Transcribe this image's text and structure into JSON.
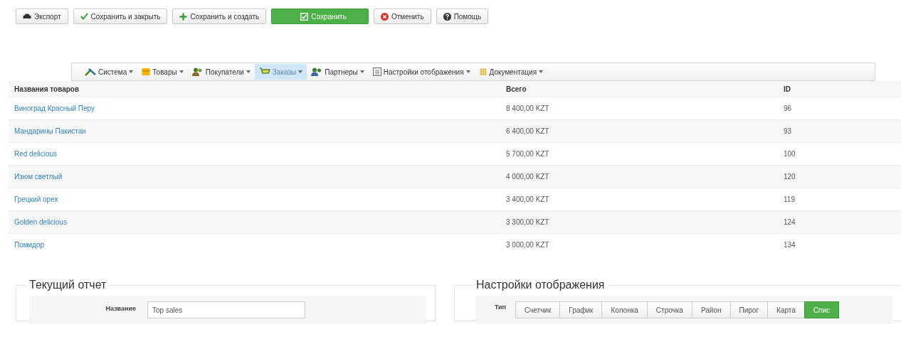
{
  "toolbar": {
    "buttons": [
      {
        "label": "Экспорт",
        "kind": "export"
      },
      {
        "label": "Сохранить и закрыть",
        "kind": "save_close"
      },
      {
        "label": "Сохранить и создать",
        "kind": "save_new"
      },
      {
        "label": "Сохранить",
        "kind": "save"
      },
      {
        "label": "Отменить",
        "kind": "cancel"
      },
      {
        "label": "Помощь",
        "kind": "help"
      }
    ]
  },
  "menu": {
    "items": [
      {
        "label": "Система",
        "kind": "system",
        "selected": false
      },
      {
        "label": "Товары",
        "kind": "goods",
        "selected": false
      },
      {
        "label": "Покупатели",
        "kind": "customers",
        "selected": false
      },
      {
        "label": "Заказы",
        "kind": "orders",
        "selected": true
      },
      {
        "label": "Партнеры",
        "kind": "partners",
        "selected": false
      },
      {
        "label": "Настройки отображения",
        "kind": "display",
        "selected": false
      },
      {
        "label": "Документация",
        "kind": "docs",
        "selected": false
      }
    ]
  },
  "table": {
    "columns": [
      "Названия товаров",
      "Всего",
      "ID"
    ],
    "rows": [
      {
        "name": "Виноград Красный Перу",
        "total": "8 400,00 KZT",
        "id": "96"
      },
      {
        "name": "Мандарины Пакистан",
        "total": "6 400,00 KZT",
        "id": "93"
      },
      {
        "name": "Red delicious",
        "total": "5 700,00 KZT",
        "id": "100"
      },
      {
        "name": "Изюм светлый",
        "total": "4 000,00 KZT",
        "id": "120"
      },
      {
        "name": "Грецкий орех",
        "total": "3 400,00 KZT",
        "id": "119"
      },
      {
        "name": "Golden delicious",
        "total": "3 300,00 KZT",
        "id": "124"
      },
      {
        "name": "Помидор",
        "total": "3 000,00 KZT",
        "id": "134"
      }
    ]
  },
  "current_report": {
    "title": "Текущий отчет",
    "fields": [
      {
        "label": "Название",
        "value": "Top sales"
      }
    ]
  },
  "display_settings": {
    "title": "Настройки отображения",
    "type_label": "Тип",
    "types": [
      {
        "label": "Счетчик",
        "selected": false
      },
      {
        "label": "График",
        "selected": false
      },
      {
        "label": "Колонка",
        "selected": false
      },
      {
        "label": "Строчка",
        "selected": false
      },
      {
        "label": "Район",
        "selected": false
      },
      {
        "label": "Пирог",
        "selected": false
      },
      {
        "label": "Карта",
        "selected": false
      },
      {
        "label": "Спис",
        "selected": true
      }
    ]
  }
}
